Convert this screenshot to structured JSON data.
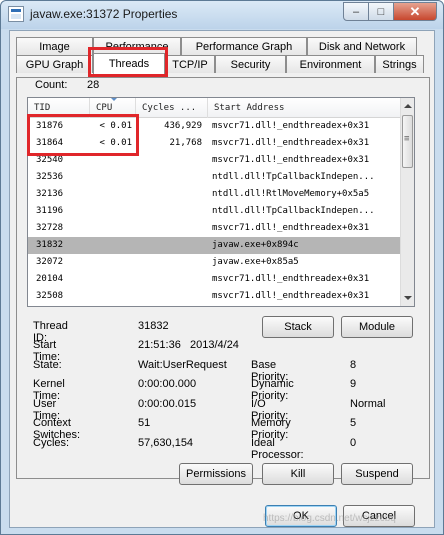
{
  "window": {
    "title": "javaw.exe:31372 Properties",
    "controls": {
      "minimize": "–",
      "maximize": "□",
      "close": "✕"
    }
  },
  "tabs": {
    "row_top": [
      "Image",
      "Performance",
      "Performance Graph",
      "Disk and Network"
    ],
    "row_bottom": [
      "GPU Graph",
      "Threads",
      "TCP/IP",
      "Security",
      "Environment",
      "Strings"
    ],
    "active": "Threads"
  },
  "threads": {
    "count_label": "Count:",
    "count_value": "28",
    "columns": [
      "TID",
      "CPU",
      "Cycles ...",
      "Start Address"
    ],
    "rows": [
      {
        "tid": "31876",
        "cpu": "< 0.01",
        "cycles": "436,929",
        "address": "msvcr71.dll!_endthreadex+0x31"
      },
      {
        "tid": "31864",
        "cpu": "< 0.01",
        "cycles": "21,768",
        "address": "msvcr71.dll!_endthreadex+0x31"
      },
      {
        "tid": "32540",
        "cpu": "",
        "cycles": "",
        "address": "msvcr71.dll!_endthreadex+0x31"
      },
      {
        "tid": "32536",
        "cpu": "",
        "cycles": "",
        "address": "ntdll.dll!TpCallbackIndepen..."
      },
      {
        "tid": "32136",
        "cpu": "",
        "cycles": "",
        "address": "ntdll.dll!RtlMoveMemory+0x5a5"
      },
      {
        "tid": "31196",
        "cpu": "",
        "cycles": "",
        "address": "ntdll.dll!TpCallbackIndepen..."
      },
      {
        "tid": "32728",
        "cpu": "",
        "cycles": "",
        "address": "msvcr71.dll!_endthreadex+0x31"
      },
      {
        "tid": "31832",
        "cpu": "",
        "cycles": "",
        "address": "javaw.exe+0x894c",
        "selected": true
      },
      {
        "tid": "32072",
        "cpu": "",
        "cycles": "",
        "address": "javaw.exe+0x85a5"
      },
      {
        "tid": "20104",
        "cpu": "",
        "cycles": "",
        "address": "msvcr71.dll!_endthreadex+0x31"
      },
      {
        "tid": "32508",
        "cpu": "",
        "cycles": "",
        "address": "msvcr71.dll!_endthreadex+0x31"
      }
    ]
  },
  "details": {
    "thread_id_label": "Thread ID:",
    "thread_id": "31832",
    "start_time_label": "Start Time:",
    "start_time": "21:51:36   2013/4/24",
    "state_label": "State:",
    "state": "Wait:UserRequest",
    "base_priority_label": "Base Priority:",
    "base_priority": "8",
    "kernel_time_label": "Kernel Time:",
    "kernel_time": "0:00:00.000",
    "dynamic_priority_label": "Dynamic Priority:",
    "dynamic_priority": "9",
    "user_time_label": "User Time:",
    "user_time": "0:00:00.015",
    "io_priority_label": "I/O Priority:",
    "io_priority": "Normal",
    "context_switches_label": "Context Switches:",
    "context_switches": "51",
    "memory_priority_label": "Memory Priority:",
    "memory_priority": "5",
    "cycles_label": "Cycles:",
    "cycles": "57,630,154",
    "ideal_processor_label": "Ideal Processor:",
    "ideal_processor": "0"
  },
  "buttons": {
    "stack": "Stack",
    "module": "Module",
    "permissions": "Permissions",
    "kill": "Kill",
    "suspend": "Suspend",
    "ok": "OK",
    "cancel": "Cancel"
  },
  "watermark": "https://blog.csdn.net/wsjzzcbq",
  "colors": {
    "highlight": "#e0262a",
    "selected_row": "#b5b5b5",
    "title_bar": "#c9dcee"
  }
}
